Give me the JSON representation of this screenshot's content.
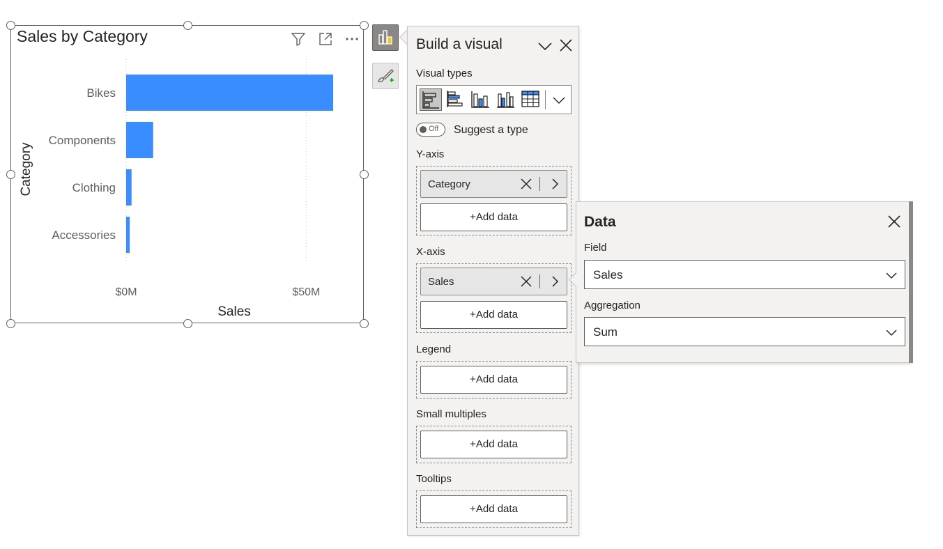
{
  "visual": {
    "title": "Sales by Category"
  },
  "chart_data": {
    "type": "bar",
    "orientation": "horizontal",
    "categories": [
      "Bikes",
      "Components",
      "Clothing",
      "Accessories"
    ],
    "values": [
      57.5,
      7.5,
      1.5,
      1.0
    ],
    "value_unit": "$M",
    "x_ticks": [
      "$0M",
      "$50M"
    ],
    "x_tick_values": [
      0,
      50
    ],
    "xlim": [
      0,
      60
    ],
    "xlabel": "Sales",
    "ylabel": "Category",
    "bar_color": "#3a8dfe",
    "grid": true,
    "legend": "none"
  },
  "build_pane": {
    "title": "Build a visual",
    "visual_types_label": "Visual types",
    "visual_type_icons": [
      "stacked-bar-chart-icon",
      "clustered-bar-chart-icon",
      "stacked-column-chart-icon",
      "clustered-column-chart-icon",
      "table-icon"
    ],
    "toggle_text": "Off",
    "suggest_label": "Suggest a type",
    "wells": {
      "y_axis": {
        "label": "Y-axis",
        "field": "Category",
        "add_label": "+Add data"
      },
      "x_axis": {
        "label": "X-axis",
        "field": "Sales",
        "add_label": "+Add data"
      },
      "legend": {
        "label": "Legend",
        "add_label": "+Add data"
      },
      "small_multiples": {
        "label": "Small multiples",
        "add_label": "+Add data"
      },
      "tooltips": {
        "label": "Tooltips",
        "add_label": "+Add data"
      }
    }
  },
  "data_pane": {
    "title": "Data",
    "field_label": "Field",
    "field_value": "Sales",
    "aggregation_label": "Aggregation",
    "aggregation_value": "Sum"
  },
  "colors": {
    "accent_bar": "#3a8dfe",
    "border": "#605e5c",
    "pane_bg": "#f3f2f1"
  }
}
